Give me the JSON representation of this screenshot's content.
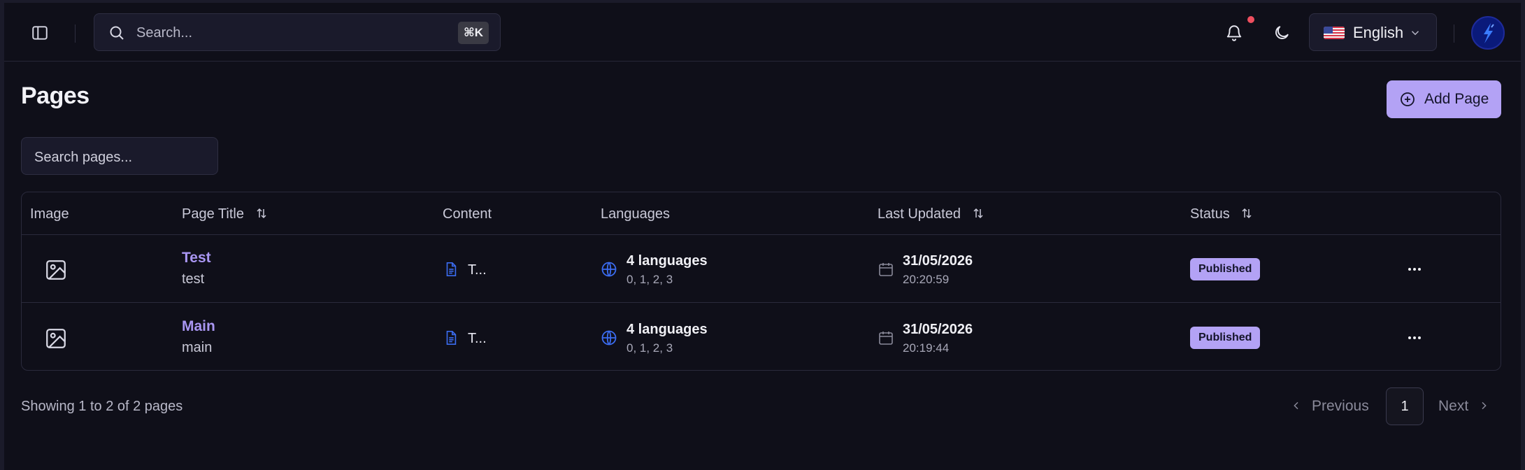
{
  "topbar": {
    "search_placeholder": "Search...",
    "shortcut": "⌘K",
    "language": "English",
    "notification_indicator": true
  },
  "page": {
    "title": "Pages",
    "add_button_label": "Add Page",
    "search_placeholder": "Search pages..."
  },
  "table": {
    "headers": {
      "image": "Image",
      "page_title": "Page Title",
      "content": "Content",
      "languages": "Languages",
      "last_updated": "Last Updated",
      "status": "Status"
    },
    "rows": [
      {
        "title": "Test",
        "slug": "test",
        "content": "T...",
        "languages_count": "4 languages",
        "language_codes": "0, 1, 2, 3",
        "date": "31/05/2026",
        "time": "20:20:59",
        "status": "Published"
      },
      {
        "title": "Main",
        "slug": "main",
        "content": "T...",
        "languages_count": "4 languages",
        "language_codes": "0, 1, 2, 3",
        "date": "31/05/2026",
        "time": "20:19:44",
        "status": "Published"
      }
    ]
  },
  "pagination": {
    "summary": "Showing 1 to 2 of 2 pages",
    "previous_label": "Previous",
    "current_page": "1",
    "next_label": "Next"
  },
  "colors": {
    "background": "#0f0f19",
    "accent": "#b3a2f5",
    "link": "#a996f2",
    "icon_blue": "#3b6cf0",
    "notification_dot": "#ef4f5f"
  }
}
